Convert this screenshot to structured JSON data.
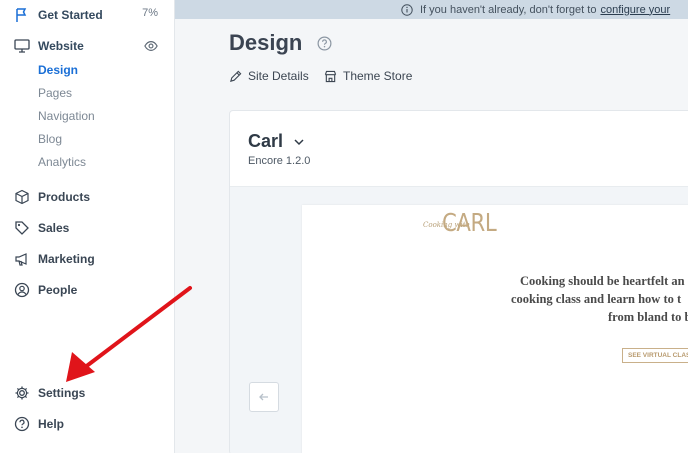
{
  "sidebar": {
    "get_started": {
      "label": "Get Started",
      "progress": "7%"
    },
    "website": {
      "label": "Website"
    },
    "website_sub": [
      {
        "label": "Design",
        "active": true
      },
      {
        "label": "Pages"
      },
      {
        "label": "Navigation"
      },
      {
        "label": "Blog"
      },
      {
        "label": "Analytics"
      }
    ],
    "products": {
      "label": "Products"
    },
    "sales": {
      "label": "Sales"
    },
    "marketing": {
      "label": "Marketing"
    },
    "people": {
      "label": "People"
    },
    "settings": {
      "label": "Settings"
    },
    "help": {
      "label": "Help"
    }
  },
  "banner": {
    "text": "If you haven't already, don't forget to",
    "link": "configure your"
  },
  "page": {
    "title": "Design",
    "site_details": "Site Details",
    "theme_store": "Theme Store"
  },
  "theme": {
    "name": "Carl",
    "version": "Encore 1.2.0"
  },
  "preview": {
    "logo_script": "Cooking with",
    "logo_main": "CARL",
    "hero": [
      "Cooking should be heartfelt an",
      "cooking class and learn how to t",
      "from bland to b"
    ],
    "cta": "SEE VIRTUAL CLASSE"
  },
  "colors": {
    "accent": "#1a6fd6",
    "banner_bg": "#cdd9e4",
    "arrow": "#e0141a"
  }
}
